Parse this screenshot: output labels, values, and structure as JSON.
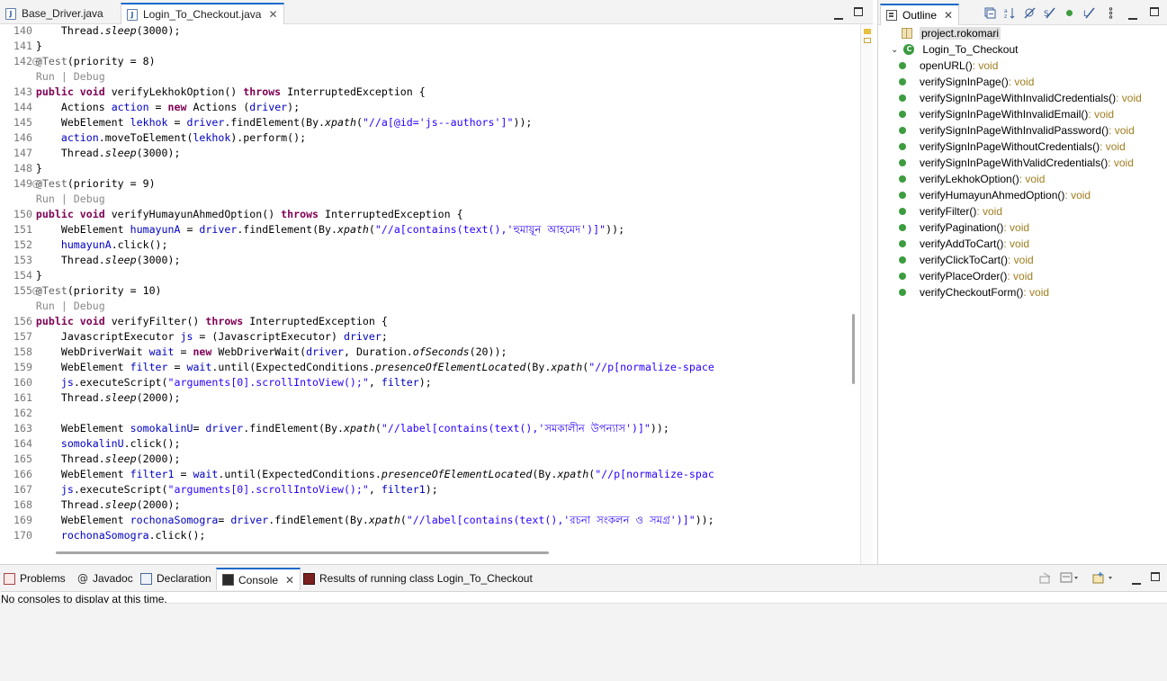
{
  "editor": {
    "tabs": [
      {
        "label": "Base_Driver.java",
        "active": false
      },
      {
        "label": "Login_To_Checkout.java",
        "active": true
      }
    ],
    "lines": [
      {
        "n": "140",
        "parts": [
          [
            "",
            "        Thread."
          ],
          [
            "st",
            "sleep"
          ],
          [
            "",
            "(3000);"
          ]
        ]
      },
      {
        "n": "141",
        "parts": [
          [
            "",
            "    }"
          ]
        ]
      },
      {
        "n": "142",
        "fold": true,
        "parts": [
          [
            "ann",
            "    @Test"
          ],
          [
            "",
            "(priority = 8)"
          ]
        ]
      },
      {
        "n": "",
        "parts": [
          [
            "run",
            "    Run | Debug"
          ]
        ]
      },
      {
        "n": "143",
        "parts": [
          [
            "kw",
            "    public void "
          ],
          [
            "",
            "verifyLekhokOption() "
          ],
          [
            "kw",
            "throws "
          ],
          [
            "",
            "InterruptedException {"
          ]
        ]
      },
      {
        "n": "144",
        "parts": [
          [
            "",
            "        Actions "
          ],
          [
            "fld",
            "action"
          ],
          [
            "",
            " = "
          ],
          [
            "kw",
            "new "
          ],
          [
            "",
            "Actions ("
          ],
          [
            "fld",
            "driver"
          ],
          [
            "",
            ");"
          ]
        ]
      },
      {
        "n": "145",
        "parts": [
          [
            "",
            "        WebElement "
          ],
          [
            "fld",
            "lekhok"
          ],
          [
            "",
            " = "
          ],
          [
            "fld",
            "driver"
          ],
          [
            "",
            ".findElement(By."
          ],
          [
            "st",
            "xpath"
          ],
          [
            "",
            "("
          ],
          [
            "str",
            "\"//a[@id='js--authors']\""
          ],
          [
            "",
            "));"
          ]
        ]
      },
      {
        "n": "146",
        "parts": [
          [
            "",
            "        "
          ],
          [
            "fld",
            "action"
          ],
          [
            "",
            ".moveToElement("
          ],
          [
            "fld",
            "lekhok"
          ],
          [
            "",
            ").perform();"
          ]
        ]
      },
      {
        "n": "147",
        "parts": [
          [
            "",
            "        Thread."
          ],
          [
            "st",
            "sleep"
          ],
          [
            "",
            "(3000);"
          ]
        ]
      },
      {
        "n": "148",
        "parts": [
          [
            "",
            "    }"
          ]
        ]
      },
      {
        "n": "149",
        "fold": true,
        "parts": [
          [
            "ann",
            "    @Test"
          ],
          [
            "",
            "(priority = 9)"
          ]
        ]
      },
      {
        "n": "",
        "parts": [
          [
            "run",
            "    Run | Debug"
          ]
        ]
      },
      {
        "n": "150",
        "parts": [
          [
            "kw",
            "    public void "
          ],
          [
            "",
            "verifyHumayunAhmedOption() "
          ],
          [
            "kw",
            "throws "
          ],
          [
            "",
            "InterruptedException {"
          ]
        ]
      },
      {
        "n": "151",
        "parts": [
          [
            "",
            "        WebElement "
          ],
          [
            "fld",
            "humayunA"
          ],
          [
            "",
            " = "
          ],
          [
            "fld",
            "driver"
          ],
          [
            "",
            ".findElement(By."
          ],
          [
            "st",
            "xpath"
          ],
          [
            "",
            "("
          ],
          [
            "str",
            "\"//a[contains(text(),'হুমায়ূন আহমেদ')]\""
          ],
          [
            "",
            "));"
          ]
        ]
      },
      {
        "n": "152",
        "parts": [
          [
            "",
            "        "
          ],
          [
            "fld",
            "humayunA"
          ],
          [
            "",
            ".click();"
          ]
        ]
      },
      {
        "n": "153",
        "parts": [
          [
            "",
            "        Thread."
          ],
          [
            "st",
            "sleep"
          ],
          [
            "",
            "(3000);"
          ]
        ]
      },
      {
        "n": "154",
        "parts": [
          [
            "",
            "    }"
          ]
        ]
      },
      {
        "n": "155",
        "fold": true,
        "parts": [
          [
            "ann",
            "    @Test"
          ],
          [
            "",
            "(priority = 10)"
          ]
        ]
      },
      {
        "n": "",
        "parts": [
          [
            "run",
            "    Run | Debug"
          ]
        ]
      },
      {
        "n": "156",
        "parts": [
          [
            "kw",
            "    public void "
          ],
          [
            "",
            "verifyFilter() "
          ],
          [
            "kw",
            "throws "
          ],
          [
            "",
            "InterruptedException {"
          ]
        ]
      },
      {
        "n": "157",
        "parts": [
          [
            "",
            "        JavascriptExecutor "
          ],
          [
            "fld",
            "js"
          ],
          [
            "",
            " = (JavascriptExecutor) "
          ],
          [
            "fld",
            "driver"
          ],
          [
            "",
            ";"
          ]
        ]
      },
      {
        "n": "158",
        "parts": [
          [
            "",
            "        WebDriverWait "
          ],
          [
            "fld",
            "wait"
          ],
          [
            "",
            " = "
          ],
          [
            "kw",
            "new "
          ],
          [
            "",
            "WebDriverWait("
          ],
          [
            "fld",
            "driver"
          ],
          [
            "",
            ", Duration."
          ],
          [
            "st",
            "ofSeconds"
          ],
          [
            "",
            "(20));"
          ]
        ]
      },
      {
        "n": "159",
        "parts": [
          [
            "",
            "        WebElement "
          ],
          [
            "fld",
            "filter"
          ],
          [
            "",
            " = "
          ],
          [
            "fld",
            "wait"
          ],
          [
            "",
            ".until(ExpectedConditions."
          ],
          [
            "st",
            "presenceOfElementLocated"
          ],
          [
            "",
            "(By."
          ],
          [
            "st",
            "xpath"
          ],
          [
            "",
            "("
          ],
          [
            "str",
            "\"//p[normalize-space"
          ]
        ]
      },
      {
        "n": "160",
        "parts": [
          [
            "",
            "        "
          ],
          [
            "fld",
            "js"
          ],
          [
            "",
            ".executeScript("
          ],
          [
            "str",
            "\"arguments[0].scrollIntoView();\""
          ],
          [
            "",
            ", "
          ],
          [
            "fld",
            "filter"
          ],
          [
            "",
            ");"
          ]
        ]
      },
      {
        "n": "161",
        "parts": [
          [
            "",
            "        Thread."
          ],
          [
            "st",
            "sleep"
          ],
          [
            "",
            "(2000);"
          ]
        ]
      },
      {
        "n": "162",
        "parts": [
          [
            "",
            ""
          ]
        ]
      },
      {
        "n": "163",
        "parts": [
          [
            "",
            "        WebElement "
          ],
          [
            "fld",
            "somokalinU"
          ],
          [
            "",
            "= "
          ],
          [
            "fld",
            "driver"
          ],
          [
            "",
            ".findElement(By."
          ],
          [
            "st",
            "xpath"
          ],
          [
            "",
            "("
          ],
          [
            "str",
            "\"//label[contains(text(),'সমকালীন উপন্যাস')]\""
          ],
          [
            "",
            "));"
          ]
        ]
      },
      {
        "n": "164",
        "parts": [
          [
            "",
            "        "
          ],
          [
            "fld",
            "somokalinU"
          ],
          [
            "",
            ".click();"
          ]
        ]
      },
      {
        "n": "165",
        "parts": [
          [
            "",
            "        Thread."
          ],
          [
            "st",
            "sleep"
          ],
          [
            "",
            "(2000);"
          ]
        ]
      },
      {
        "n": "166",
        "parts": [
          [
            "",
            "        WebElement "
          ],
          [
            "fld",
            "filter1"
          ],
          [
            "",
            " = "
          ],
          [
            "fld",
            "wait"
          ],
          [
            "",
            ".until(ExpectedConditions."
          ],
          [
            "st",
            "presenceOfElementLocated"
          ],
          [
            "",
            "(By."
          ],
          [
            "st",
            "xpath"
          ],
          [
            "",
            "("
          ],
          [
            "str",
            "\"//p[normalize-spac"
          ]
        ]
      },
      {
        "n": "167",
        "parts": [
          [
            "",
            "        "
          ],
          [
            "fld",
            "js"
          ],
          [
            "",
            ".executeScript("
          ],
          [
            "str",
            "\"arguments[0].scrollIntoView();\""
          ],
          [
            "",
            ", "
          ],
          [
            "fld",
            "filter1"
          ],
          [
            "",
            ");"
          ]
        ]
      },
      {
        "n": "168",
        "parts": [
          [
            "",
            "        Thread."
          ],
          [
            "st",
            "sleep"
          ],
          [
            "",
            "(2000);"
          ]
        ]
      },
      {
        "n": "169",
        "parts": [
          [
            "",
            "        WebElement "
          ],
          [
            "fld",
            "rochonaSomogra"
          ],
          [
            "",
            "= "
          ],
          [
            "fld",
            "driver"
          ],
          [
            "",
            ".findElement(By."
          ],
          [
            "st",
            "xpath"
          ],
          [
            "",
            "("
          ],
          [
            "str",
            "\"//label[contains(text(),'রচনা সংকলন ও সমগ্র')]\""
          ],
          [
            "",
            "));"
          ]
        ]
      },
      {
        "n": "170",
        "parts": [
          [
            "",
            "        "
          ],
          [
            "fld",
            "rochonaSomogra"
          ],
          [
            "",
            ".click();"
          ]
        ]
      }
    ]
  },
  "outline": {
    "tab_label": "Outline",
    "package": "project.rokomari",
    "class_name": "Login_To_Checkout",
    "methods": [
      {
        "name": "openURL()",
        "ret": " : void"
      },
      {
        "name": "verifySignInPage()",
        "ret": " : void"
      },
      {
        "name": "verifySignInPageWithInvalidCredentials()",
        "ret": " : void"
      },
      {
        "name": "verifySignInPageWithInvalidEmail()",
        "ret": " : void"
      },
      {
        "name": "verifySignInPageWithInvalidPassword()",
        "ret": " : void"
      },
      {
        "name": "verifySignInPageWithoutCredentials()",
        "ret": " : void"
      },
      {
        "name": "verifySignInPageWithValidCredentials()",
        "ret": " : void"
      },
      {
        "name": "verifyLekhokOption()",
        "ret": " : void"
      },
      {
        "name": "verifyHumayunAhmedOption()",
        "ret": " : void"
      },
      {
        "name": "verifyFilter()",
        "ret": " : void"
      },
      {
        "name": "verifyPagination()",
        "ret": " : void"
      },
      {
        "name": "verifyAddToCart()",
        "ret": " : void"
      },
      {
        "name": "verifyClickToCart()",
        "ret": " : void"
      },
      {
        "name": "verifyPlaceOrder()",
        "ret": " : void"
      },
      {
        "name": "verifyCheckoutForm()",
        "ret": " : void"
      }
    ]
  },
  "bottom": {
    "tabs": {
      "problems": "Problems",
      "javadoc": "Javadoc",
      "declaration": "Declaration",
      "console": "Console",
      "junit": "Results of running class Login_To_Checkout"
    },
    "console_message": "No consoles to display at this time."
  }
}
